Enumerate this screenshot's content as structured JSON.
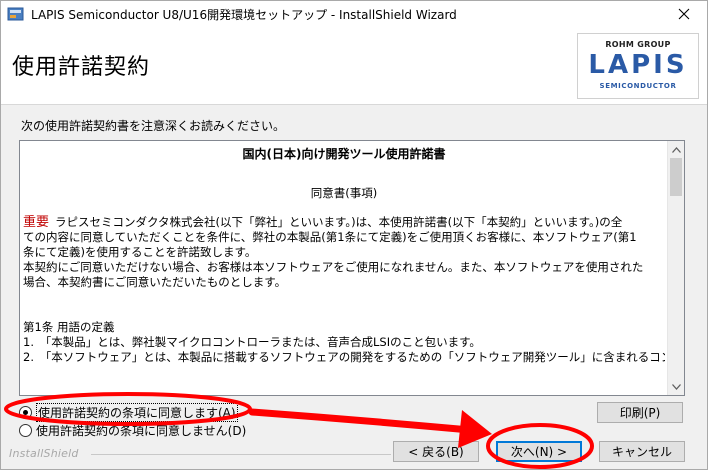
{
  "window": {
    "title": "LAPIS Semiconductor U8/U16開発環境セットアップ - InstallShield Wizard"
  },
  "header": {
    "page_title": "使用許諾契約",
    "logo_group": "ROHM GROUP",
    "logo_main": "LAPIS",
    "logo_sub": "SEMICONDUCTOR"
  },
  "instruction": "次の使用許諾契約書を注意深くお読みください。",
  "license": {
    "heading": "国内(日本)向け開発ツール使用許諾書",
    "subheading": "同意書(事項)",
    "important_label": "重要",
    "para1_lines": [
      "ラピスセミコンダクタ株式会社(以下「弊社」といいます。)は、本使用許諾書(以下「本契約」といいます。)の全",
      "ての内容に同意していただくことを条件に、弊社の本製品(第1条にて定義)をご使用頂くお客様に、本ソフトウェア(第1",
      "条にて定義)を使用することを許諾致します。"
    ],
    "para2_lines": [
      "本契約にご同意いただけない場合、お客様は本ソフトウェアをご使用になれません。また、本ソフトウェアを使用された",
      "場合、本契約書にご同意いただいたものとします。"
    ],
    "section_title": "第1条 用語の定義",
    "item1": "1.　「本製品」とは、弊社製マイクロコントローラまたは、音声合成LSIのこと包います。",
    "item2": "2.　「本ソフトウェア」とは、本製品に搭載するソフトウェアの開発をするための「ソフトウェア開発ツール」に含まれるコン"
  },
  "radios": {
    "accept": "使用許諾契約の条項に同意します(A)",
    "decline": "使用許諾契約の条項に同意しません(D)",
    "selected": "accept"
  },
  "buttons": {
    "print": "印刷(P)",
    "back": "< 戻る(B)",
    "next": "次へ(N) >",
    "cancel": "キャンセル"
  },
  "brand": "InstallShield",
  "colors": {
    "annotation": "#ff0000",
    "logo_blue": "#2a5aa6",
    "important_red": "#c00000",
    "focus_blue": "#0078d7"
  }
}
